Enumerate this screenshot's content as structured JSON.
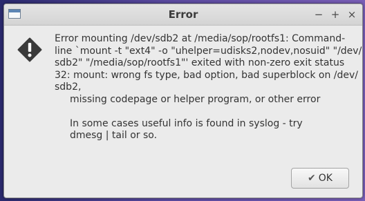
{
  "window": {
    "title": "Error",
    "controls": {
      "minimize": "−",
      "maximize": "+",
      "close": "×"
    }
  },
  "dialog": {
    "icon": "warning-icon",
    "message_lines": [
      {
        "text": "Error mounting /dev/sdb2 at /media/sop/rootfs1: Command-"
      },
      {
        "text": "line `mount -t \"ext4\" -o \"uhelper=udisks2,nodev,nosuid\" \"/dev/"
      },
      {
        "text": "sdb2\" \"/media/sop/rootfs1\"' exited with non-zero exit status"
      },
      {
        "text": "32: mount: wrong fs type, bad option, bad superblock on /dev/"
      },
      {
        "text": "sdb2,"
      },
      {
        "text": "missing codepage or helper program, or other error"
      },
      {
        "text": ""
      },
      {
        "text": "In some cases useful info is found in syslog - try"
      },
      {
        "text": "dmesg | tail or so."
      }
    ],
    "ok_label": "OK",
    "ok_icon": "check-icon"
  },
  "colors": {
    "warning_icon": "#3a3a3a",
    "dialog_background": "#ebebeb"
  }
}
